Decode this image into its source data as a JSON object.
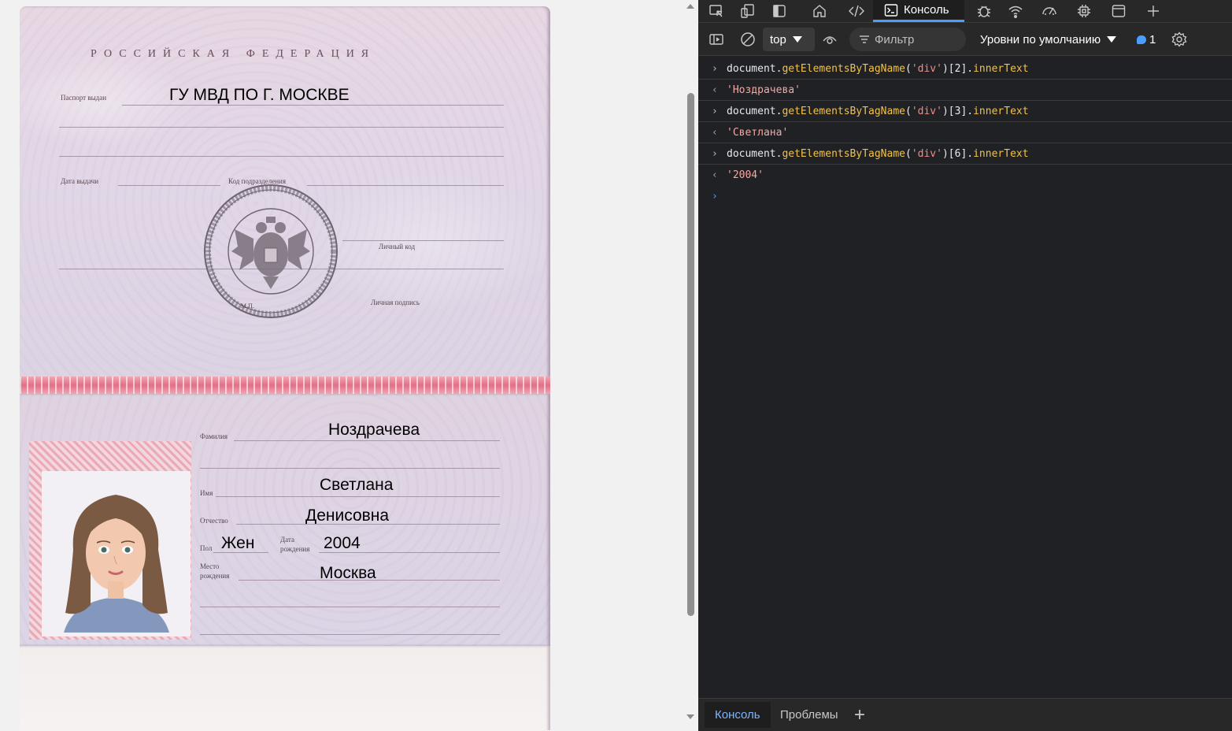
{
  "passport": {
    "country_header": "РОССИЙСКАЯ ФЕДЕРАЦИЯ",
    "issued_by_label": "Паспорт выдан",
    "issued_by_value": "ГУ МВД ПО Г. МОСКВЕ",
    "issue_date_label": "Дата выдачи",
    "division_code_label": "Код подразделения",
    "personal_code_label": "Личный код",
    "signature_label": "Личная подпись",
    "stamp_mp": "М.П.",
    "surname_label": "Фамилия",
    "surname_value": "Ноздрачева",
    "name_label": "Имя",
    "name_value": "Светлана",
    "patronymic_label": "Отчество",
    "patronymic_value": "Денисовна",
    "sex_label": "Пол",
    "sex_value": "Жен",
    "birth_date_label_1": "Дата",
    "birth_date_label_2": "рождения",
    "birth_date_value": "2004",
    "birth_place_label_1": "Место",
    "birth_place_label_2": "рождения",
    "birth_place_value": "Москва"
  },
  "devtools": {
    "active_tab": "Консоль",
    "toolbar": {
      "context": "top",
      "filter_placeholder": "Фильтр",
      "levels": "Уровни по умолчанию",
      "issues_count": "1"
    },
    "console": [
      {
        "kind": "input",
        "obj": "document",
        "dot": ".",
        "method": "getElementsByTagName",
        "open": "(",
        "arg": "'div'",
        "close": ")[2].",
        "prop": "innerText"
      },
      {
        "kind": "output",
        "value": "'Ноздрачева'"
      },
      {
        "kind": "input",
        "obj": "document",
        "dot": ".",
        "method": "getElementsByTagName",
        "open": "(",
        "arg": "'div'",
        "close": ")[3].",
        "prop": "innerText"
      },
      {
        "kind": "output",
        "value": "'Светлана'"
      },
      {
        "kind": "input",
        "obj": "document",
        "dot": ".",
        "method": "getElementsByTagName",
        "open": "(",
        "arg": "'div'",
        "close": ")[6].",
        "prop": "innerText"
      },
      {
        "kind": "output",
        "value": "'2004'"
      }
    ],
    "drawer": {
      "console_tab": "Консоль",
      "problems_tab": "Проблемы",
      "add_tab": "+"
    },
    "colors": {
      "accent": "#4a9eff",
      "string": "#f28b82",
      "method": "#f0c24b"
    }
  }
}
